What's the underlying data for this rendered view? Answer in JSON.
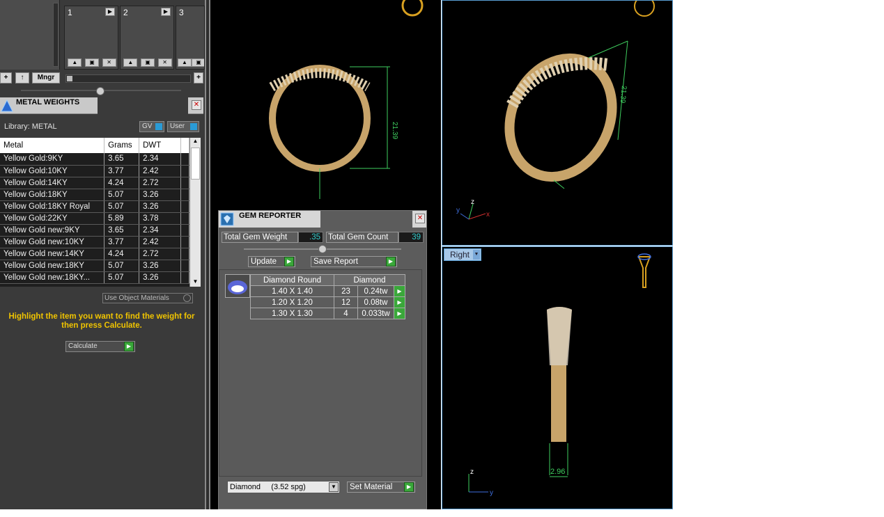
{
  "slots": [
    {
      "label": "1"
    },
    {
      "label": "2"
    },
    {
      "label": "3"
    }
  ],
  "toolbar": {
    "add_label": "+",
    "up_label": "↑",
    "mngr_label": "Mngr",
    "add_right_label": "+"
  },
  "metal_weights": {
    "title": "METAL WEIGHTS",
    "library_label": "Library: METAL",
    "gv_label": "GV",
    "user_label": "User",
    "columns": [
      "Metal",
      "Grams",
      "DWT"
    ],
    "rows": [
      {
        "metal": "Yellow Gold:9KY",
        "grams": "3.65",
        "dwt": "2.34"
      },
      {
        "metal": "Yellow Gold:10KY",
        "grams": "3.77",
        "dwt": "2.42"
      },
      {
        "metal": "Yellow Gold:14KY",
        "grams": "4.24",
        "dwt": "2.72"
      },
      {
        "metal": "Yellow Gold:18KY",
        "grams": "5.07",
        "dwt": "3.26"
      },
      {
        "metal": "Yellow Gold:18KY Royal",
        "grams": "5.07",
        "dwt": "3.26"
      },
      {
        "metal": "Yellow Gold:22KY",
        "grams": "5.89",
        "dwt": "3.78"
      },
      {
        "metal": "Yellow Gold new:9KY",
        "grams": "3.65",
        "dwt": "2.34"
      },
      {
        "metal": "Yellow Gold new:10KY",
        "grams": "3.77",
        "dwt": "2.42"
      },
      {
        "metal": "Yellow Gold new:14KY",
        "grams": "4.24",
        "dwt": "2.72"
      },
      {
        "metal": "Yellow Gold new:18KY",
        "grams": "5.07",
        "dwt": "3.26"
      },
      {
        "metal": "Yellow Gold new:18KY...",
        "grams": "5.07",
        "dwt": "3.26"
      }
    ],
    "use_object_materials": "Use Object Materials",
    "hint": "Highlight the item you want to find the weight for then press Calculate.",
    "calculate_label": "Calculate"
  },
  "gem_reporter": {
    "title": "GEM REPORTER",
    "total_weight_label": "Total Gem Weight",
    "total_weight_value": ".35",
    "total_count_label": "Total Gem Count",
    "total_count_value": "39",
    "update_label": "Update",
    "save_report_label": "Save Report",
    "group_header": [
      "Diamond Round",
      "Diamond"
    ],
    "gems": [
      {
        "size": "1.40 X 1.40",
        "count": "23",
        "weight": "0.24tw"
      },
      {
        "size": "1.20 X 1.20",
        "count": "12",
        "weight": "0.08tw"
      },
      {
        "size": "1.30 X 1.30",
        "count": "4",
        "weight": "0.033tw"
      }
    ],
    "material_select": "Diamond     (3.52 spg)",
    "set_material_label": "Set Material"
  },
  "viewports": {
    "right_view_label": "Right",
    "dim_front": "21.39",
    "dim_persp": "21.39",
    "dim_right": "2.96",
    "axes": {
      "z": "z",
      "x": "x",
      "y": "y"
    }
  },
  "colors": {
    "accent": "#5aa0d6",
    "gold": "#c8a46a",
    "dimension": "#3fcf5f",
    "hint": "#f0c400"
  }
}
